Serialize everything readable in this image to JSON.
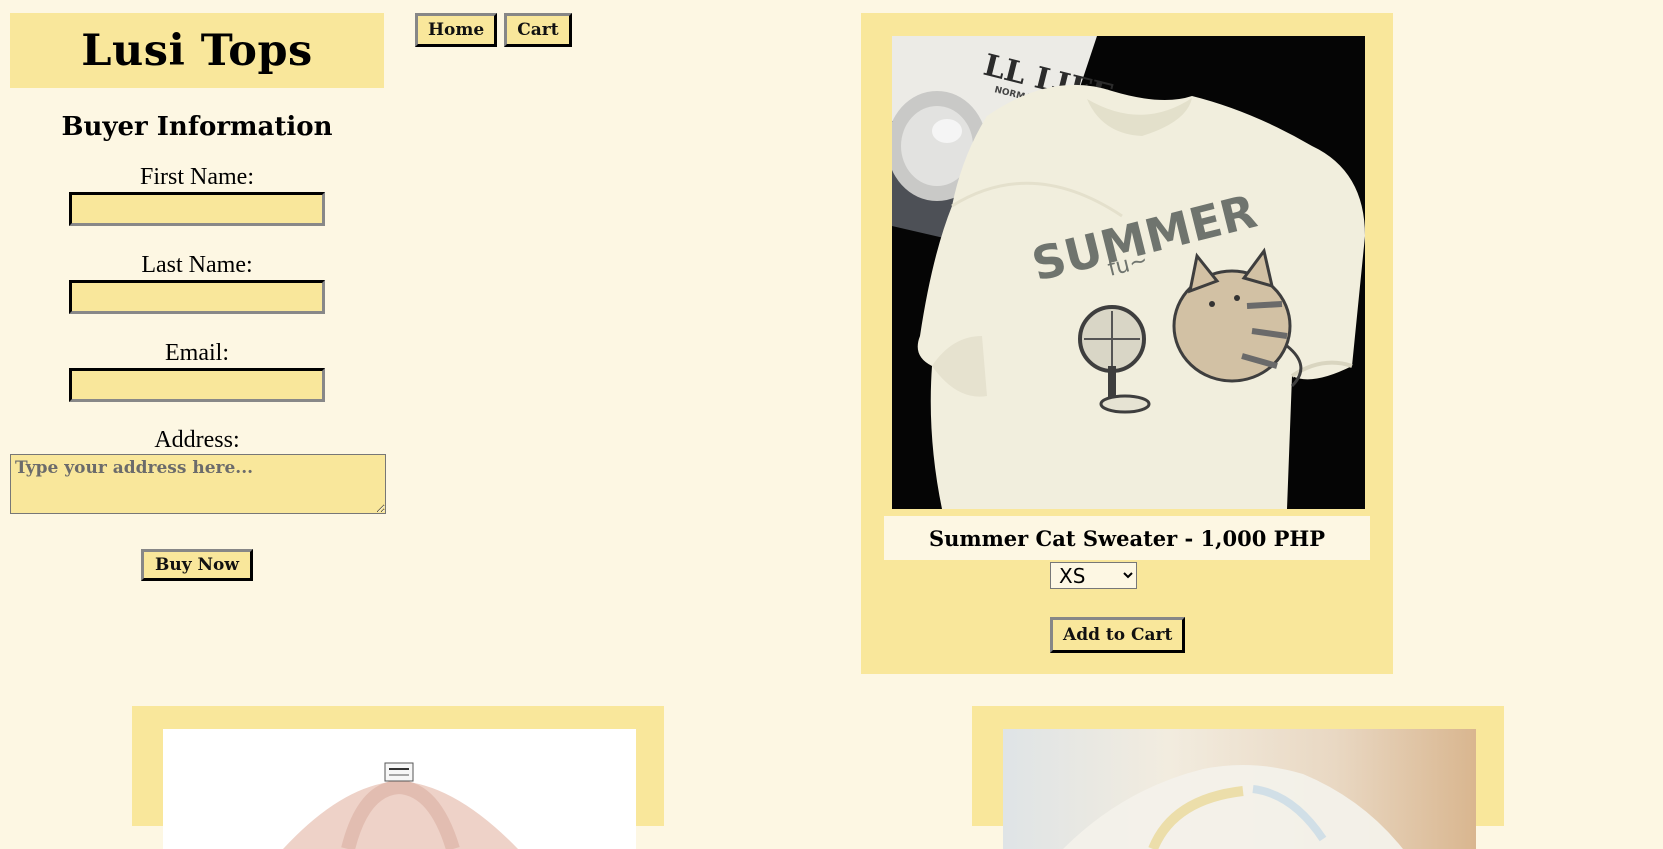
{
  "brand": {
    "title": "Lusi Tops"
  },
  "nav": {
    "home_label": "Home",
    "cart_label": "Cart"
  },
  "buyer": {
    "heading": "Buyer Information",
    "first_name_label": "First Name:",
    "last_name_label": "Last Name:",
    "email_label": "Email:",
    "address_label": "Address:",
    "address_placeholder": "Type your address here...",
    "buy_label": "Buy Now"
  },
  "product": {
    "title": "Summer Cat Sweater - 1,000 PHP",
    "size_selected": "XS",
    "add_label": "Add to Cart",
    "shirt_text": "SUMMER",
    "shirt_subtext": "fu~",
    "magazine_text": "LL LIFE",
    "magazine_subtext": "NORMAL PEOPLE"
  },
  "colors": {
    "background": "#fdf7e3",
    "panel": "#f9e79b"
  }
}
